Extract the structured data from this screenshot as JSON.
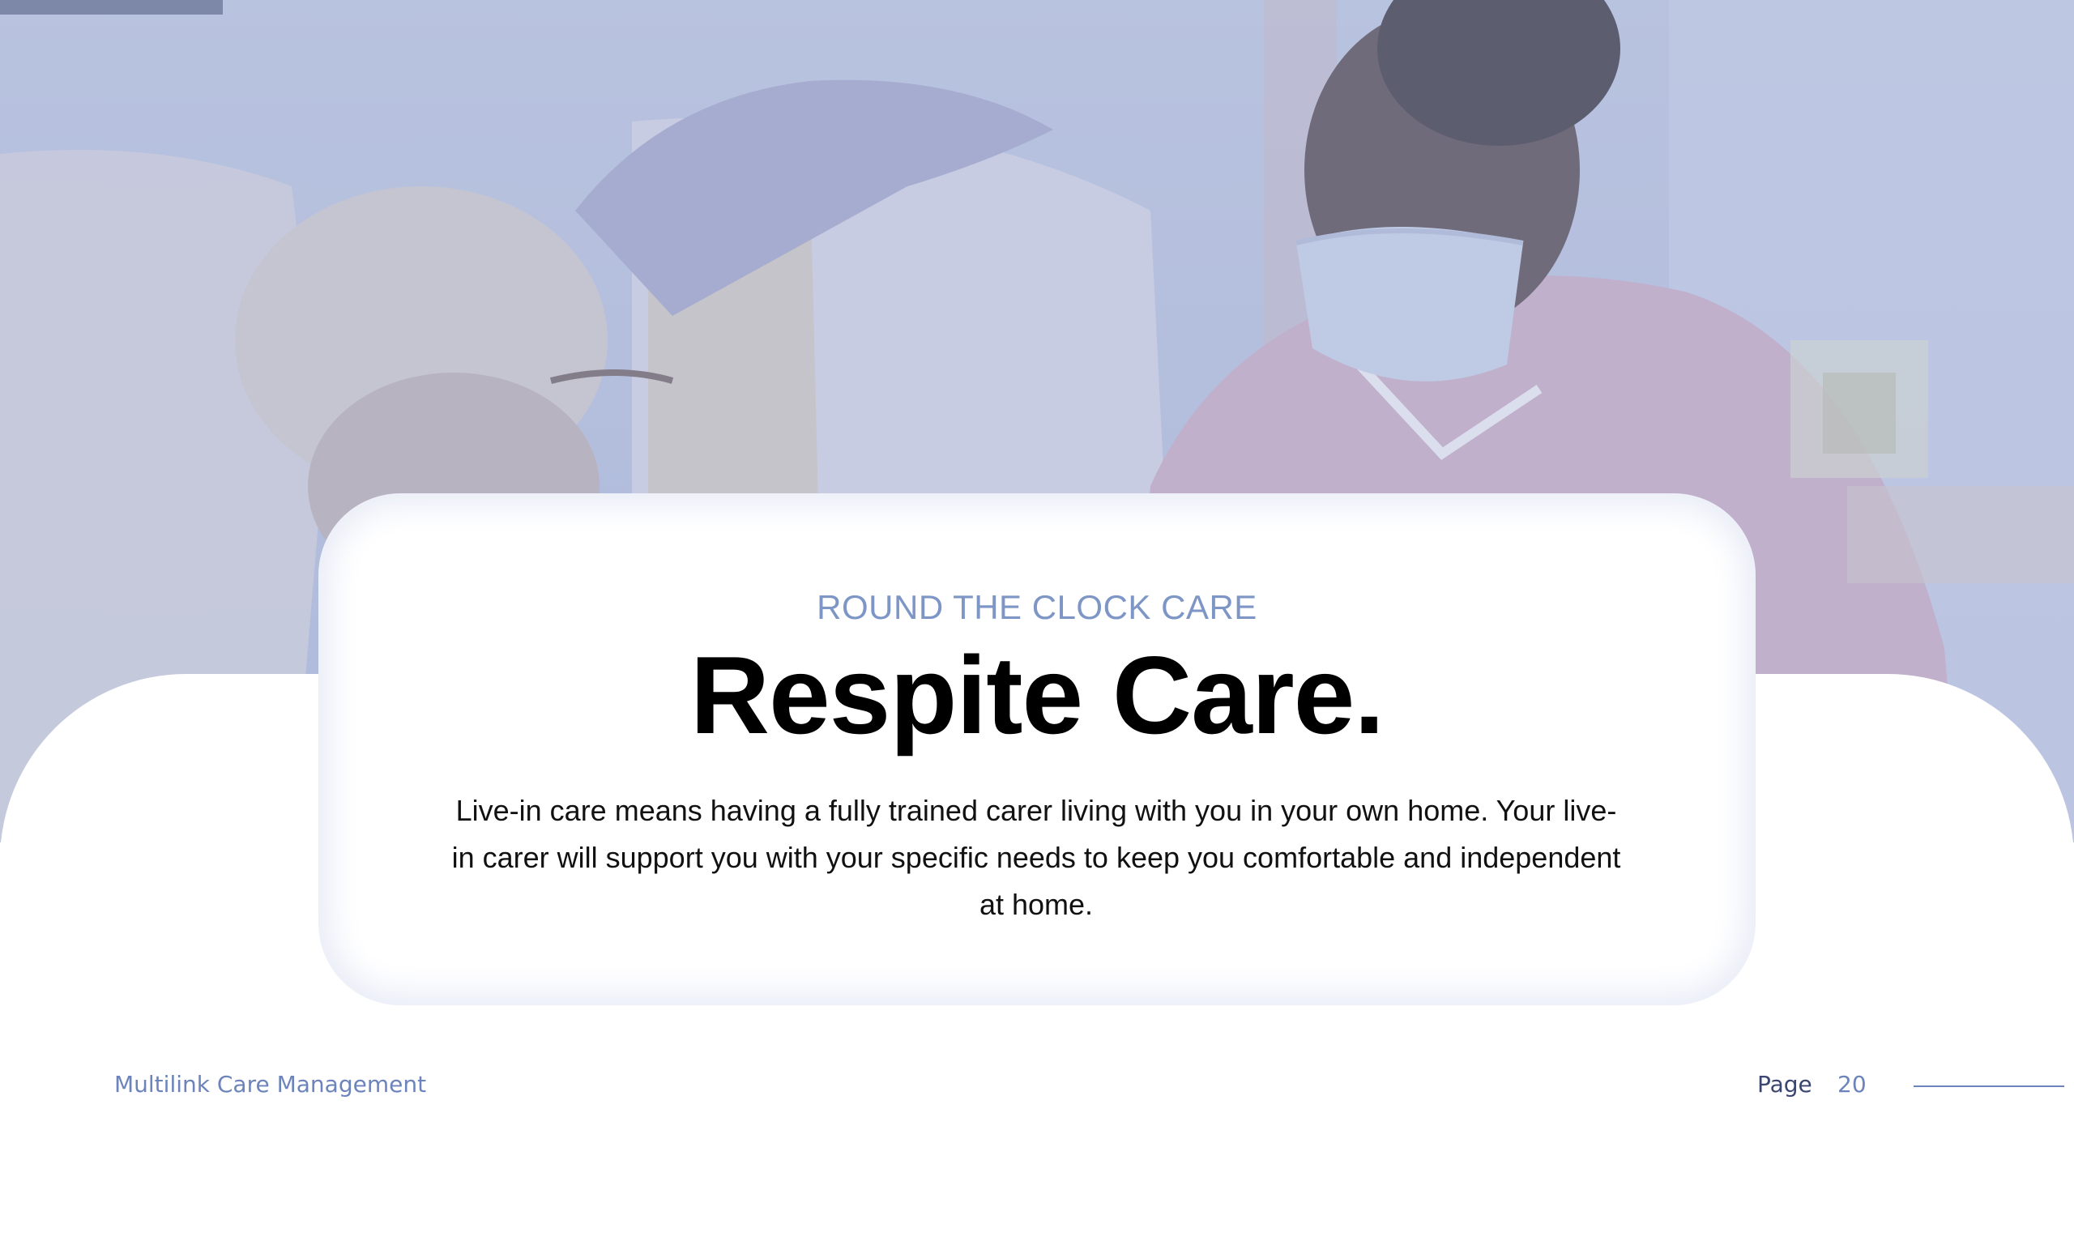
{
  "card": {
    "eyebrow": "ROUND THE CLOCK CARE",
    "headline": "Respite Care.",
    "body": "Live-in care means having a fully trained carer living with you in your own home. Your live-in carer will support you with your specific needs to keep you comfortable and independent at home."
  },
  "footer": {
    "company": "Multilink Care Management",
    "page_label": "Page",
    "page_number": "20"
  },
  "colors": {
    "accent": "#7d96c6",
    "overlay": "#b3bedd",
    "text": "#000000"
  }
}
